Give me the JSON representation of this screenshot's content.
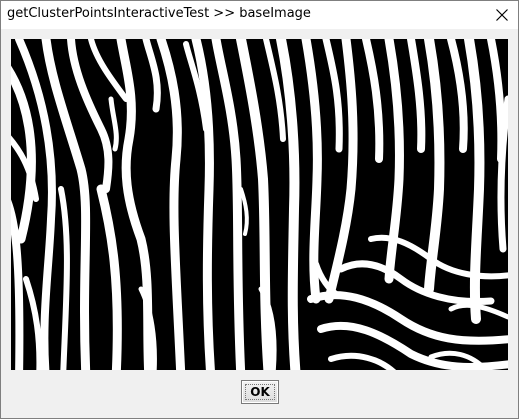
{
  "window": {
    "title": "getClusterPointsInteractiveTest >> baseImage",
    "close_icon": "close-icon"
  },
  "image": {
    "description_icon": "zebra-stripe-image",
    "fg_color": "#000000",
    "bg_color": "#ffffff"
  },
  "footer": {
    "ok_label": "OK"
  }
}
